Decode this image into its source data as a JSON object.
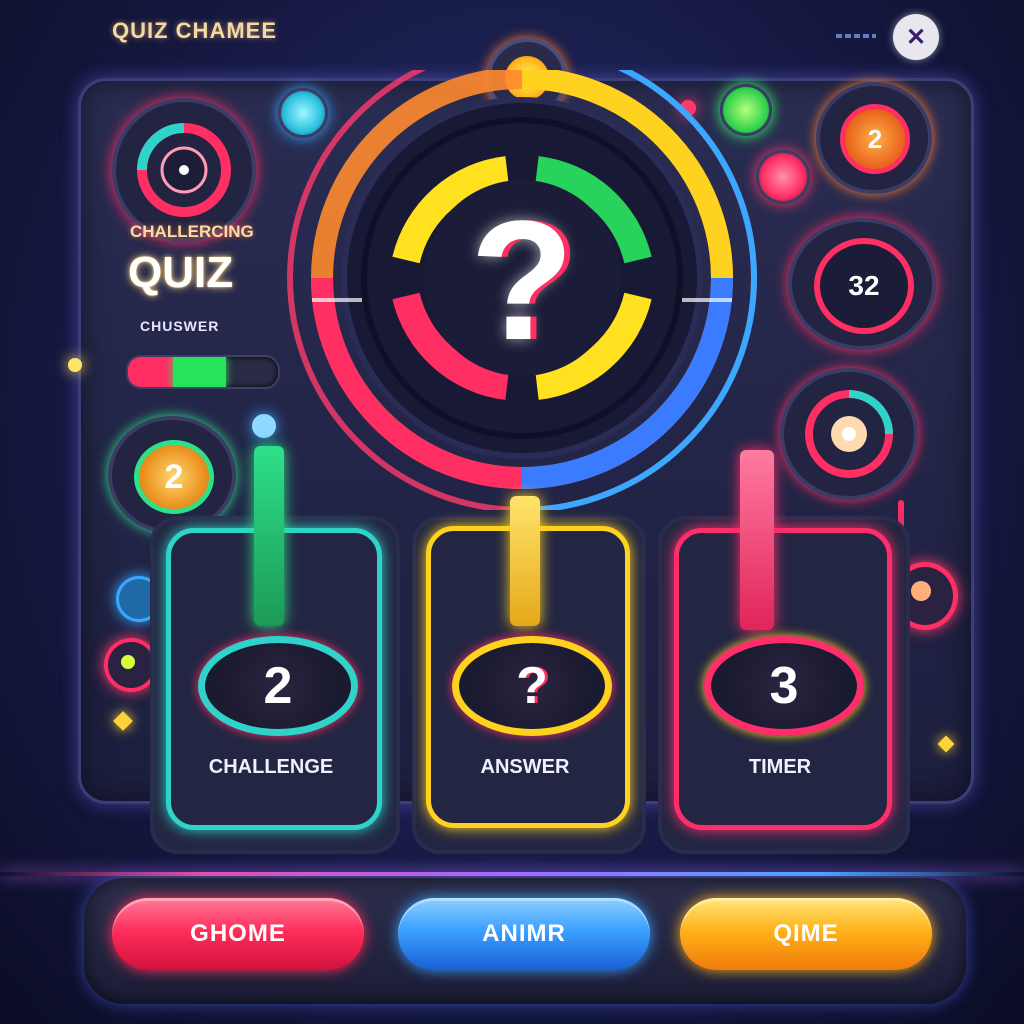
{
  "header": {
    "title": "QUIZ CHAMЕE",
    "close_icon": "close-icon",
    "close_label": "✕"
  },
  "left": {
    "title_small": "CHALLERCING",
    "title_big": "QUIZ",
    "subtitle": "CHUSWER",
    "badge_value": "2",
    "progress": {
      "segments": [
        {
          "color": "#ff2e63",
          "fraction": 0.3
        },
        {
          "color": "#27e35a",
          "fraction": 0.35
        }
      ]
    }
  },
  "center": {
    "question_symbol": "?"
  },
  "right": {
    "badge_top": "2",
    "timer_value": "32"
  },
  "cards": [
    {
      "label": "CHALLENGE",
      "value": "2",
      "color": "#2fd3c9"
    },
    {
      "label": "ANSWER",
      "value": "?",
      "color": "#ffd21f"
    },
    {
      "label": "TIMER",
      "value": "3",
      "color": "#ff2e6b"
    }
  ],
  "buttons": [
    {
      "label": "GHOME",
      "color": "#ff2e5a"
    },
    {
      "label": "ANIMR",
      "color": "#3aa0ff"
    },
    {
      "label": "QIME",
      "color": "#ffb21a"
    }
  ]
}
